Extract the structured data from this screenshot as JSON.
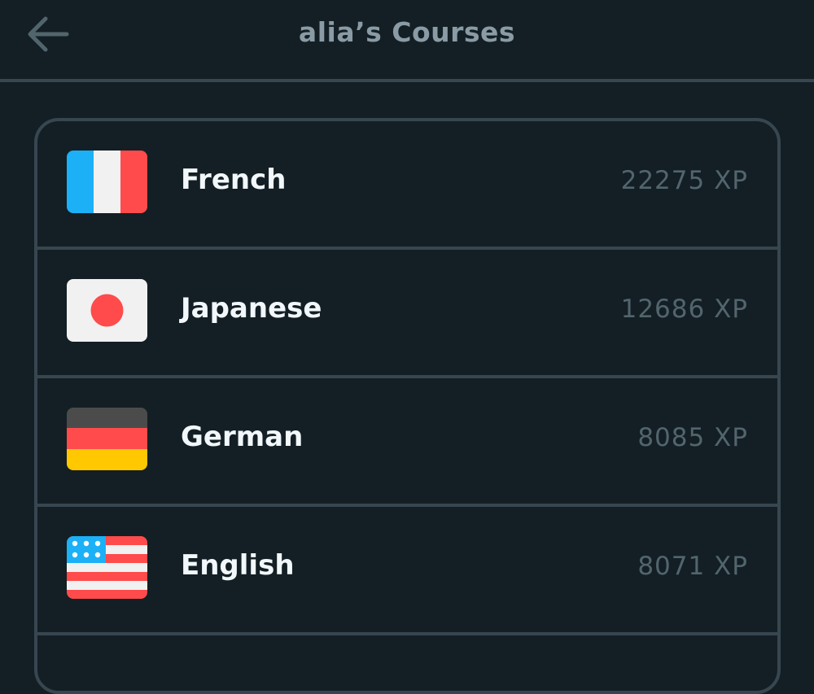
{
  "header": {
    "title": "alia’s Courses",
    "back_icon": "arrow-left-icon"
  },
  "courses": [
    {
      "name": "French",
      "xp": "22275 XP",
      "flag": "france-flag-icon"
    },
    {
      "name": "Japanese",
      "xp": "12686 XP",
      "flag": "japan-flag-icon"
    },
    {
      "name": "German",
      "xp": "8085 XP",
      "flag": "germany-flag-icon"
    },
    {
      "name": "English",
      "xp": "8071 XP",
      "flag": "usa-flag-icon"
    }
  ],
  "colors": {
    "background": "#131f24",
    "border": "#37464f",
    "title": "#8a9ba5",
    "course_name": "#f1f7fb",
    "xp": "#52656d"
  }
}
